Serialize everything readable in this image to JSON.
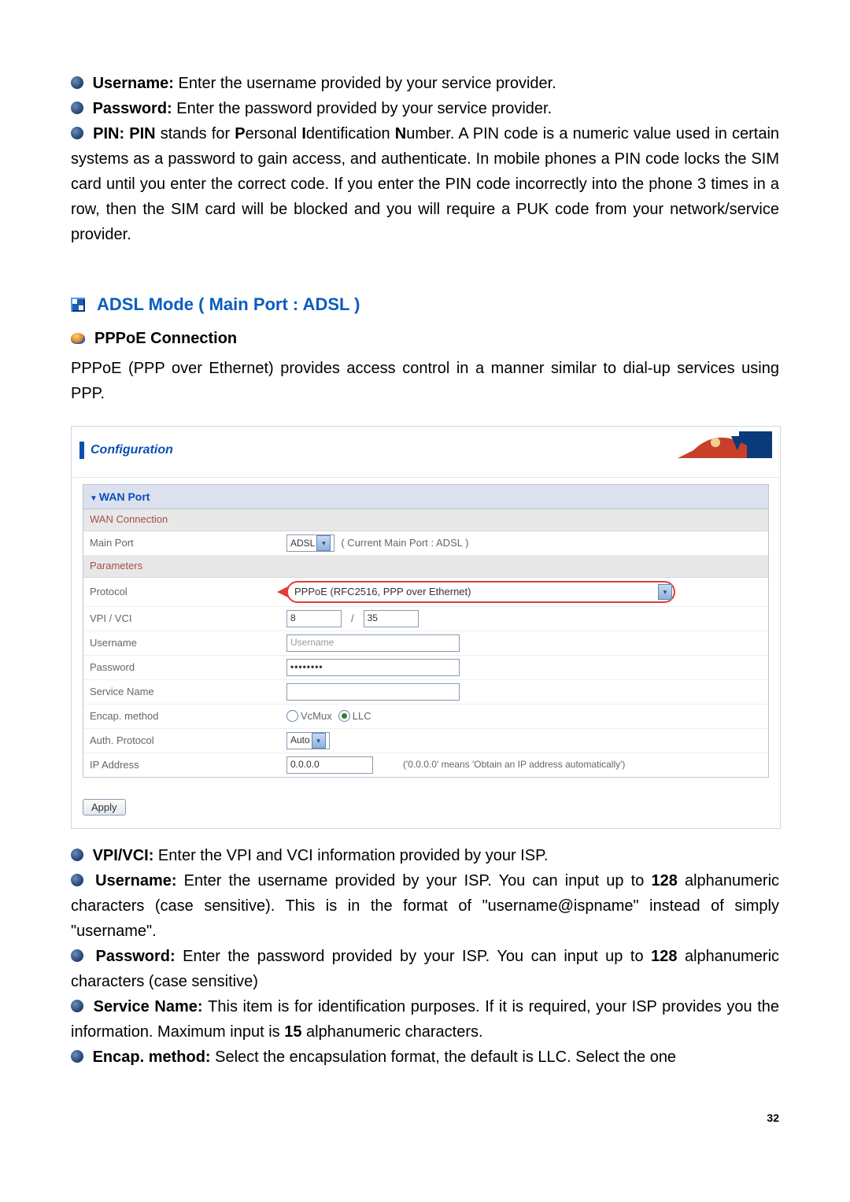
{
  "top": {
    "username_label": "Username: ",
    "username_text": "Enter the username provided by your service provider.",
    "password_label": "Password: ",
    "password_text": "Enter the password provided by your service provider.",
    "pin_label": "PIN: PIN ",
    "pin_text1": "stands for ",
    "pin_p": "P",
    "pin_text2": "ersonal ",
    "pin_i": "I",
    "pin_text3": "dentification ",
    "pin_n": "N",
    "pin_text4": "umber. A PIN code is a numeric value used in certain systems as a password to gain access, and authenticate. In mobile phones a PIN code locks the SIM card until you enter the correct code. If you enter the PIN code incorrectly into the phone 3 times in a row, then the SIM card will be blocked and you will require a PUK code from your network/service provider."
  },
  "section": {
    "title": "ADSL Mode ( Main Port : ADSL )",
    "sub_title": "PPPoE Connection",
    "desc": "PPPoE (PPP over Ethernet) provides access control in a manner similar to dial-up services using PPP."
  },
  "panel": {
    "config_title": "Configuration",
    "wan_port": "WAN Port",
    "wan_connection": "WAN Connection",
    "main_port_label": "Main Port",
    "main_port_value": "ADSL",
    "main_port_hint": "( Current Main Port : ADSL )",
    "parameters": "Parameters",
    "protocol_label": "Protocol",
    "protocol_value": "PPPoE (RFC2516, PPP over Ethernet)",
    "vpivci_label": "VPI / VCI",
    "vpi_value": "8",
    "vci_value": "35",
    "username_label": "Username",
    "username_placeholder": "Username",
    "password_label": "Password",
    "password_value": "••••••••",
    "service_name_label": "Service Name",
    "service_name_value": "",
    "encap_label": "Encap. method",
    "encap_vcmux": "VcMux",
    "encap_llc": "LLC",
    "auth_label": "Auth. Protocol",
    "auth_value": "Auto",
    "ip_label": "IP Address",
    "ip_value": "0.0.0.0",
    "ip_hint": "('0.0.0.0' means 'Obtain an IP address automatically')",
    "apply": "Apply"
  },
  "post": {
    "vpivci_label": "VPI/VCI: ",
    "vpivci_text": "Enter the VPI and VCI information provided by your ISP.",
    "username_label": "Username: ",
    "username_text1": "Enter the username provided by your ISP. You can input up to ",
    "username_128": "128",
    "username_text2": " alphanumeric characters (case sensitive). This is in the format of \"username@ispname\" instead of simply \"username\".",
    "password_label": "Password: ",
    "password_text1": "Enter the password provided by your ISP. You can input up to ",
    "password_128": "128",
    "password_text2": " alphanumeric characters (case sensitive)",
    "service_label": "Service Name: ",
    "service_text1": "This item is for identification purposes. If it is required, your ISP provides you the information. Maximum input is ",
    "service_15": "15",
    "service_text2": " alphanumeric characters.",
    "encap_label": "Encap. method: ",
    "encap_text": "Select the encapsulation format, the default is LLC. Select the one"
  },
  "page_number": "32"
}
